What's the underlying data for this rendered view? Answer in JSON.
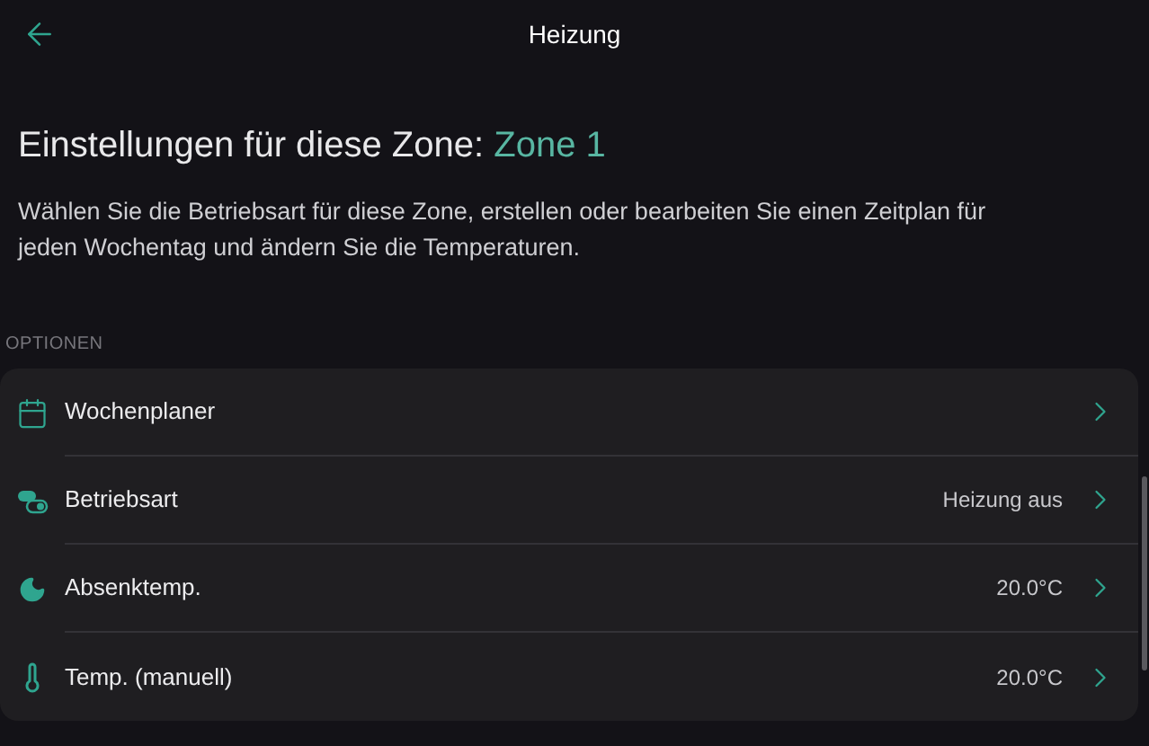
{
  "header": {
    "title": "Heizung"
  },
  "heading": {
    "text": "Einstellungen für diese Zone:",
    "zone": "Zone 1"
  },
  "description": "Wählen Sie die Betriebsart für diese Zone, erstellen oder bearbeiten Sie einen Zeitplan für jeden Wochentag und ändern Sie die Temperaturen.",
  "section_label": "OPTIONEN",
  "options": [
    {
      "kind": "calendar",
      "label": "Wochenplaner"
    },
    {
      "kind": "mode",
      "label": "Betriebsart",
      "value": "Heizung aus"
    },
    {
      "kind": "moon",
      "label": "Absenktemp.",
      "value": "20.0°C"
    },
    {
      "kind": "thermometer",
      "label": "Temp. (manuell)",
      "value": "20.0°C"
    }
  ]
}
